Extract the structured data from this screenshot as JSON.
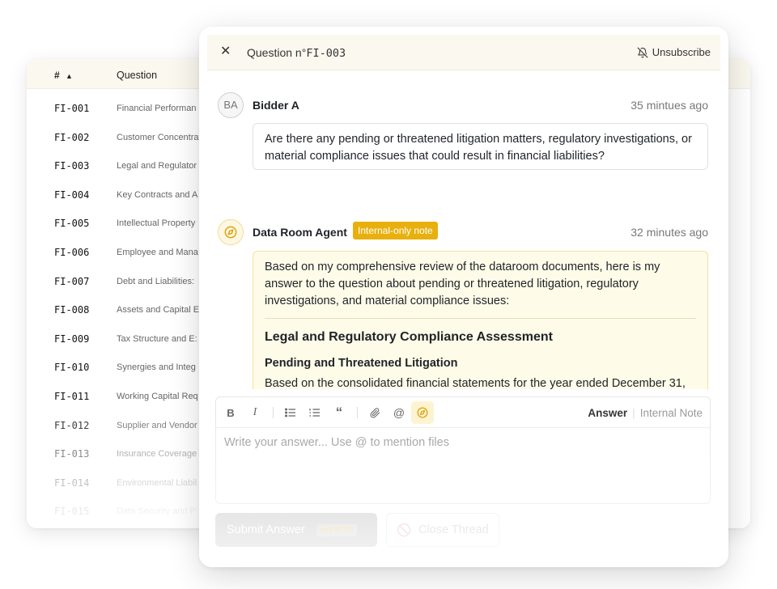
{
  "table": {
    "header": {
      "num_label": "#",
      "sort_icon": "chevron-up-icon",
      "question_label": "Question"
    },
    "rows": [
      {
        "id": "FI-001",
        "question": "Financial Performan"
      },
      {
        "id": "FI-002",
        "question": "Customer Concentrat"
      },
      {
        "id": "FI-003",
        "question": "Legal and Regulator"
      },
      {
        "id": "FI-004",
        "question": "Key Contracts and A"
      },
      {
        "id": "FI-005",
        "question": "Intellectual Property"
      },
      {
        "id": "FI-006",
        "question": "Employee and Mana"
      },
      {
        "id": "FI-007",
        "question": "Debt and Liabilities:"
      },
      {
        "id": "FI-008",
        "question": "Assets and Capital E"
      },
      {
        "id": "FI-009",
        "question": "Tax Structure and E:"
      },
      {
        "id": "FI-010",
        "question": "Synergies and Integ"
      },
      {
        "id": "FI-011",
        "question": "Working Capital Req"
      },
      {
        "id": "FI-012",
        "question": "Supplier and Vendor"
      },
      {
        "id": "FI-013",
        "question": "Insurance Coverage"
      },
      {
        "id": "FI-014",
        "question": "Environmental Liabil"
      },
      {
        "id": "FI-015",
        "question": "Data Security and P"
      }
    ]
  },
  "modal": {
    "close_icon": "close-icon",
    "title_prefix": "Question n°",
    "title_id": "FI-003",
    "unsubscribe_label": "Unsubscribe",
    "messages": [
      {
        "avatar": "BA",
        "sender": "Bidder A",
        "time": "35 mintues ago",
        "body": "Are there any pending or threatened litigation matters, regulatory investigations, or material compliance issues that could result in financial liabilities?"
      },
      {
        "avatar_icon": "compass-icon",
        "sender": "Data Room Agent",
        "tag": "Internal-only note",
        "time": "32 minutes ago",
        "intro": "Based on my comprehensive review of the dataroom documents, here is my answer to the question about pending or threatened litigation, regulatory investigations, and material compliance issues:",
        "heading": "Legal and Regulatory Compliance Assessment",
        "subheading": "Pending and Threatened Litigation",
        "paragraph": "Based on the consolidated financial statements for the year ended December 31,"
      }
    ],
    "editor": {
      "toolbar": [
        "bold-icon",
        "italic-icon",
        "bullet-list-icon",
        "numbered-list-icon",
        "quote-icon",
        "attach-icon",
        "mention-icon",
        "compass-icon"
      ],
      "mode_answer": "Answer",
      "mode_note": "Internal Note",
      "placeholder": "Write your answer... Use @ to mention files"
    },
    "submit_label": "Submit Answer",
    "submit_shortcut": "⌘+ENTER",
    "close_thread_label": "Close Thread"
  },
  "colors": {
    "accent": "#e8b00e",
    "agent_bg": "#fefbe8",
    "header_bg": "#fbf8ef"
  }
}
